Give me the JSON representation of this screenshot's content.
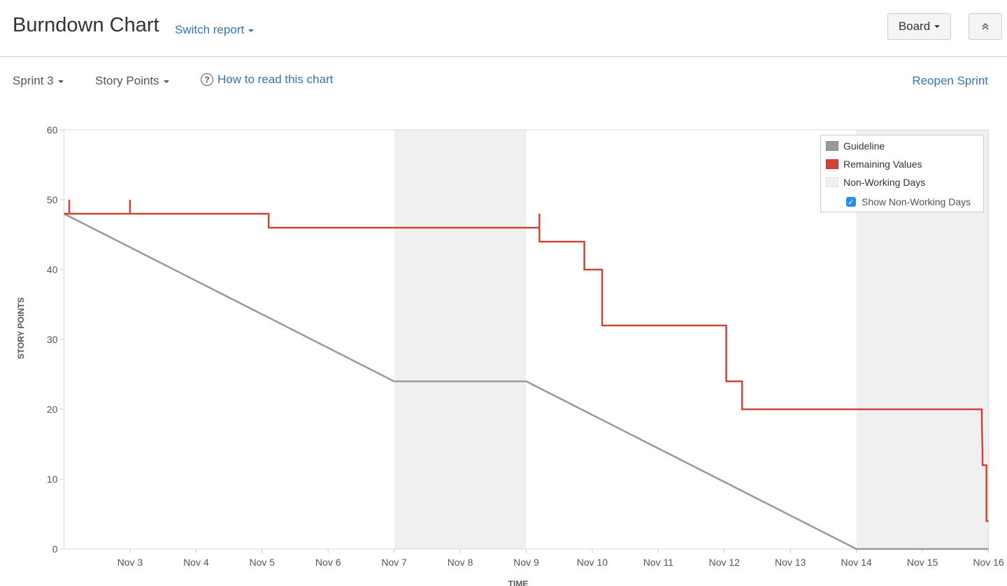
{
  "header": {
    "title": "Burndown Chart",
    "switch_report": "Switch report",
    "board_button": "Board",
    "collapse_icon": "double-chevron-up-icon"
  },
  "toolbar": {
    "sprint": "Sprint 3",
    "estimation": "Story Points",
    "help_icon": "question-circle-icon",
    "help_link": "How to read this chart",
    "reopen": "Reopen Sprint"
  },
  "legend": {
    "guideline": "Guideline",
    "remaining": "Remaining Values",
    "non_working": "Non-Working Days",
    "show_non_working": "Show Non-Working Days",
    "show_non_working_checked": true
  },
  "colors": {
    "guideline": "#999999",
    "remaining": "#d04437",
    "non_working": "#f0f0f0",
    "link": "#3b73af"
  },
  "chart_data": {
    "type": "line",
    "title": "Burndown Chart",
    "xlabel": "TIME",
    "ylabel": "STORY POINTS",
    "ylim": [
      0,
      60
    ],
    "yticks": [
      0,
      10,
      20,
      30,
      40,
      50,
      60
    ],
    "xlim": [
      2,
      16
    ],
    "xtick_values": [
      3,
      4,
      5,
      6,
      7,
      8,
      9,
      10,
      11,
      12,
      13,
      14,
      15,
      16
    ],
    "xtick_labels": [
      "Nov 3",
      "Nov 4",
      "Nov 5",
      "Nov 6",
      "Nov 7",
      "Nov 8",
      "Nov 9",
      "Nov 10",
      "Nov 11",
      "Nov 12",
      "Nov 13",
      "Nov 14",
      "Nov 15",
      "Nov 16"
    ],
    "x_units": "day of November",
    "non_working_ranges": [
      [
        7,
        9
      ],
      [
        14,
        16
      ]
    ],
    "legend_position": "top-right",
    "grid": false,
    "series": [
      {
        "name": "Guideline",
        "points": [
          [
            2,
            48
          ],
          [
            7,
            24
          ],
          [
            9,
            24
          ],
          [
            14,
            0
          ],
          [
            16,
            0
          ]
        ]
      },
      {
        "name": "Remaining Values",
        "step": true,
        "points": [
          [
            2,
            48
          ],
          [
            2.08,
            48
          ],
          [
            2.08,
            50
          ],
          [
            2.08,
            48
          ],
          [
            3,
            48
          ],
          [
            3,
            50
          ],
          [
            3,
            48
          ],
          [
            5.1,
            48
          ],
          [
            5.1,
            46
          ],
          [
            9.2,
            46
          ],
          [
            9.2,
            48
          ],
          [
            9.2,
            44
          ],
          [
            9.88,
            44
          ],
          [
            9.88,
            40
          ],
          [
            10.15,
            40
          ],
          [
            10.15,
            32
          ],
          [
            12.03,
            32
          ],
          [
            12.03,
            24
          ],
          [
            12.27,
            24
          ],
          [
            12.27,
            20
          ],
          [
            15.9,
            20
          ],
          [
            15.9,
            18
          ],
          [
            15.91,
            14
          ],
          [
            15.91,
            12
          ],
          [
            15.97,
            12
          ],
          [
            15.97,
            4
          ],
          [
            16,
            4
          ]
        ]
      }
    ]
  }
}
